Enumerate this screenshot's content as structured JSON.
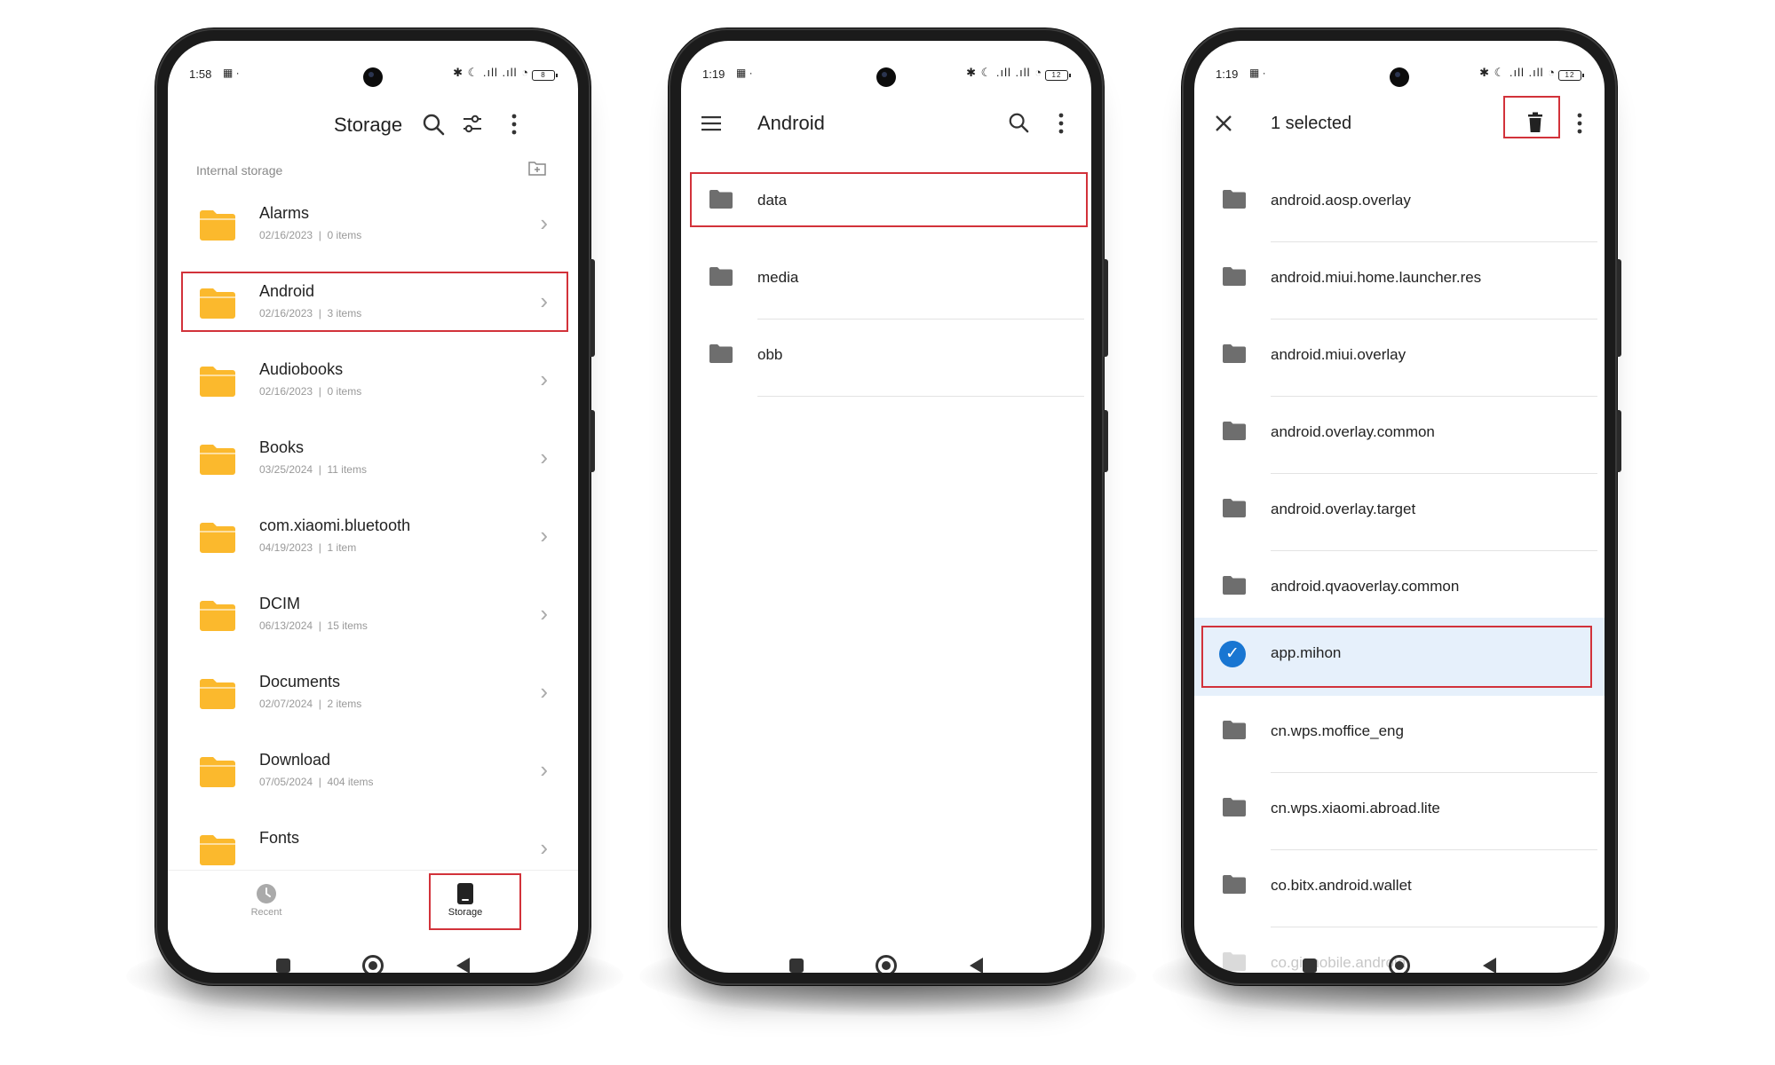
{
  "colors": {
    "accent_red": "#d2323a",
    "folder_yellow": "#fbb92d",
    "folder_gray": "#6e6e6e",
    "select_blue": "#1976d2",
    "select_bg": "#e6f0fb"
  },
  "phone1": {
    "status": {
      "time": "1:58",
      "battery": "8"
    },
    "title": "Storage",
    "section_label": "Internal storage",
    "folders": [
      {
        "name": "Alarms",
        "date": "02/16/2023",
        "count": "0 items"
      },
      {
        "name": "Android",
        "date": "02/16/2023",
        "count": "3 items"
      },
      {
        "name": "Audiobooks",
        "date": "02/16/2023",
        "count": "0 items"
      },
      {
        "name": "Books",
        "date": "03/25/2024",
        "count": "11 items"
      },
      {
        "name": "com.xiaomi.bluetooth",
        "date": "04/19/2023",
        "count": "1 item"
      },
      {
        "name": "DCIM",
        "date": "06/13/2024",
        "count": "15 items"
      },
      {
        "name": "Documents",
        "date": "02/07/2024",
        "count": "2 items"
      },
      {
        "name": "Download",
        "date": "07/05/2024",
        "count": "404 items"
      },
      {
        "name": "Fonts",
        "date": "",
        "count": ""
      }
    ],
    "nav": {
      "recent": "Recent",
      "storage": "Storage"
    }
  },
  "phone2": {
    "status": {
      "time": "1:19",
      "battery": "12"
    },
    "title": "Android",
    "folders": [
      "data",
      "media",
      "obb"
    ]
  },
  "phone3": {
    "status": {
      "time": "1:19",
      "battery": "12"
    },
    "title": "1 selected",
    "folders": [
      "android.aosp.overlay",
      "android.miui.home.launcher.res",
      "android.miui.overlay",
      "android.overlay.common",
      "android.overlay.target",
      "android.qvaoverlay.common",
      "app.mihon",
      "cn.wps.moffice_eng",
      "cn.wps.xiaomi.abroad.lite",
      "co.bitx.android.wallet",
      "co.gi mobile.android"
    ]
  }
}
